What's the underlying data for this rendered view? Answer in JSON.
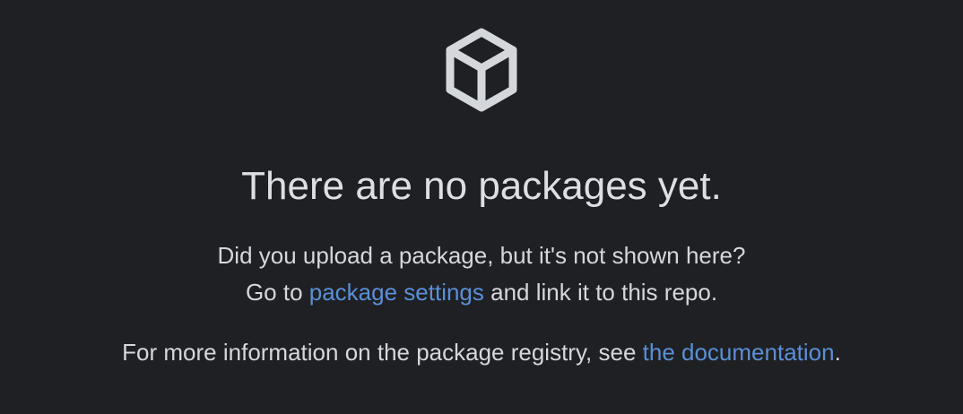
{
  "empty_state": {
    "icon": "package-icon",
    "title": "There are no packages yet.",
    "line1": "Did you upload a package, but it's not shown here?",
    "line2_prefix": "Go to ",
    "line2_link": "package settings",
    "line2_suffix": " and link it to this repo.",
    "line3_prefix": "For more information on the package registry, see ",
    "line3_link": "the documentation",
    "line3_suffix": "."
  },
  "colors": {
    "background": "#1e2023",
    "text": "#d4d7dc",
    "link": "#5b8fd6",
    "icon": "#d4d7dc"
  }
}
